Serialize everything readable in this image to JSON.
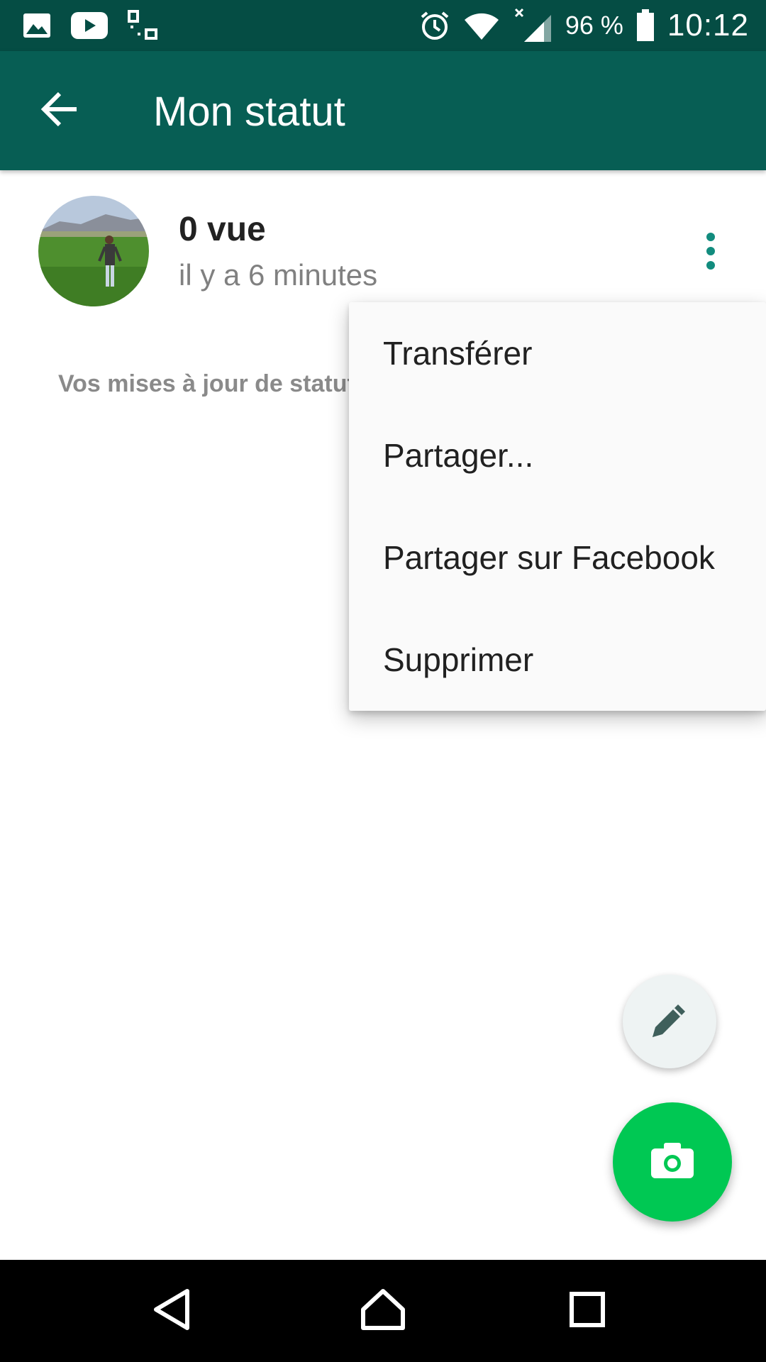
{
  "status_bar": {
    "battery_text": "96 %",
    "time": "10:12",
    "icons": [
      "gallery-icon",
      "youtube-icon",
      "qr-scan-icon",
      "alarm-icon",
      "wifi-icon",
      "signal-icon",
      "battery-icon"
    ]
  },
  "app_bar": {
    "title": "Mon statut",
    "background": "#075e54"
  },
  "status_entry": {
    "views": "0 vue",
    "time_ago": "il y a 6 minutes"
  },
  "info": {
    "text": "Vos mises à jour de statut"
  },
  "menu": {
    "items": [
      {
        "label": "Transférer"
      },
      {
        "label": "Partager..."
      },
      {
        "label": "Partager sur Facebook"
      },
      {
        "label": "Supprimer"
      }
    ]
  },
  "fabs": {
    "edit_icon": "pencil-icon",
    "camera_icon": "camera-icon",
    "camera_color": "#00c853"
  },
  "nav": {
    "buttons": [
      "back-triangle-icon",
      "home-icon",
      "recents-icon"
    ]
  }
}
